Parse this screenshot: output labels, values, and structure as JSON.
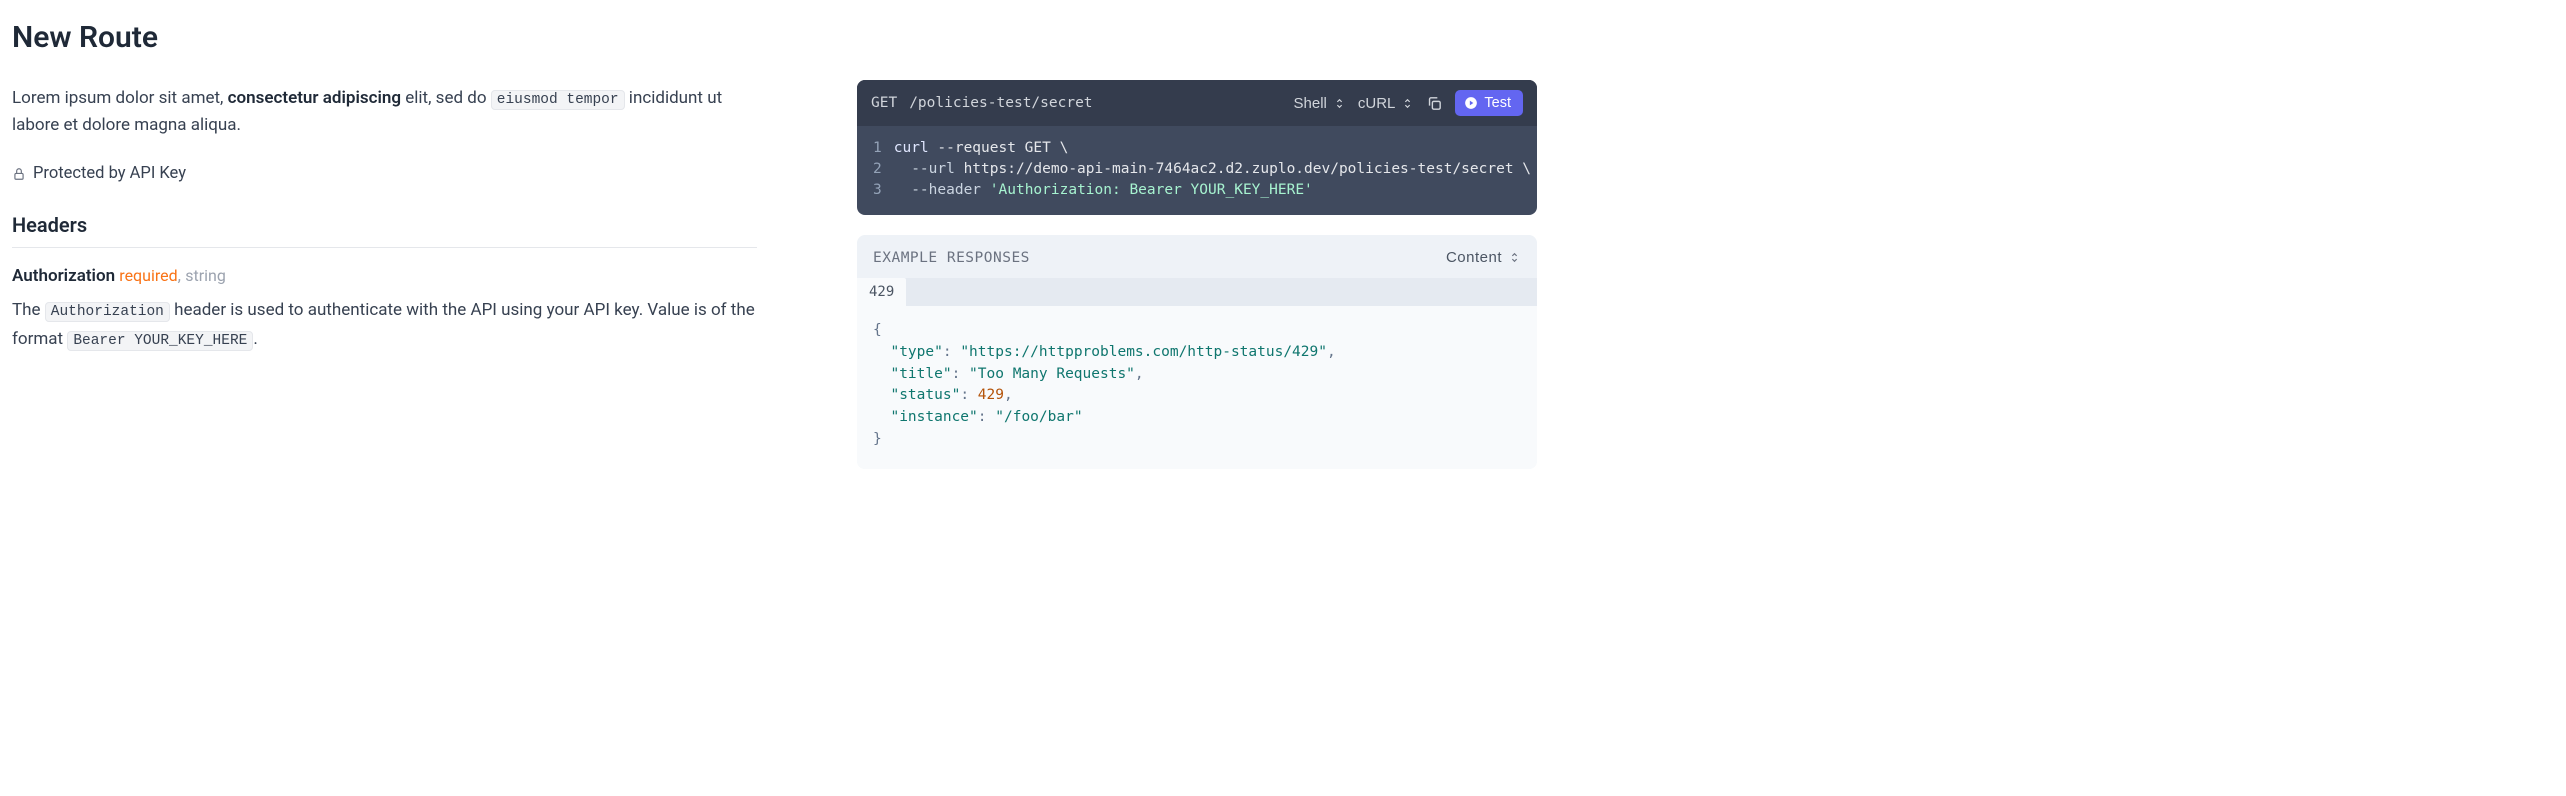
{
  "title": "New Route",
  "intro": {
    "p1_prefix": "Lorem ipsum dolor sit amet, ",
    "bold": "consectetur adipiscing",
    "p1_mid": " elit, sed do ",
    "code": "eiusmod tempor",
    "p1_suffix": " incididunt ut labore et dolore magna aliqua."
  },
  "protected_label": "Protected by API Key",
  "headers_title": "Headers",
  "header": {
    "name": "Authorization",
    "required": "required",
    "comma": ",",
    "type": "string",
    "desc_prefix": "The ",
    "desc_code1": "Authorization",
    "desc_mid": " header is used to authenticate with the API using your API key. Value is of the format ",
    "desc_code2": "Bearer YOUR_KEY_HERE",
    "desc_suffix": "."
  },
  "code_panel": {
    "method": "GET",
    "path": "/policies-test/secret",
    "lang_selector": "Shell",
    "tool_selector": "cURL",
    "test_label": "Test",
    "gutter": {
      "l1": "1",
      "l2": "2",
      "l3": "3"
    },
    "code": {
      "l1_cmd": "curl",
      "l1_rest": " --request GET \\",
      "l2_flag": "  --url",
      "l2_url": " https://demo-api-main-7464ac2.d2.zuplo.dev/policies-test/secret ",
      "l2_slash": "\\",
      "l3_flag": "  --header",
      "l3_str": " 'Authorization: Bearer YOUR_KEY_HERE'"
    }
  },
  "response": {
    "title": "EXAMPLE RESPONSES",
    "content_selector": "Content",
    "tab": "429",
    "json": {
      "open": "{",
      "k1": "\"type\"",
      "c1": ": ",
      "v1": "\"https://httpproblems.com/http-status/429\"",
      "e1": ",",
      "k2": "\"title\"",
      "c2": ": ",
      "v2": "\"Too Many Requests\"",
      "e2": ",",
      "k3": "\"status\"",
      "c3": ": ",
      "v3": "429",
      "e3": ",",
      "k4": "\"instance\"",
      "c4": ": ",
      "v4": "\"/foo/bar\"",
      "close": "}"
    }
  }
}
